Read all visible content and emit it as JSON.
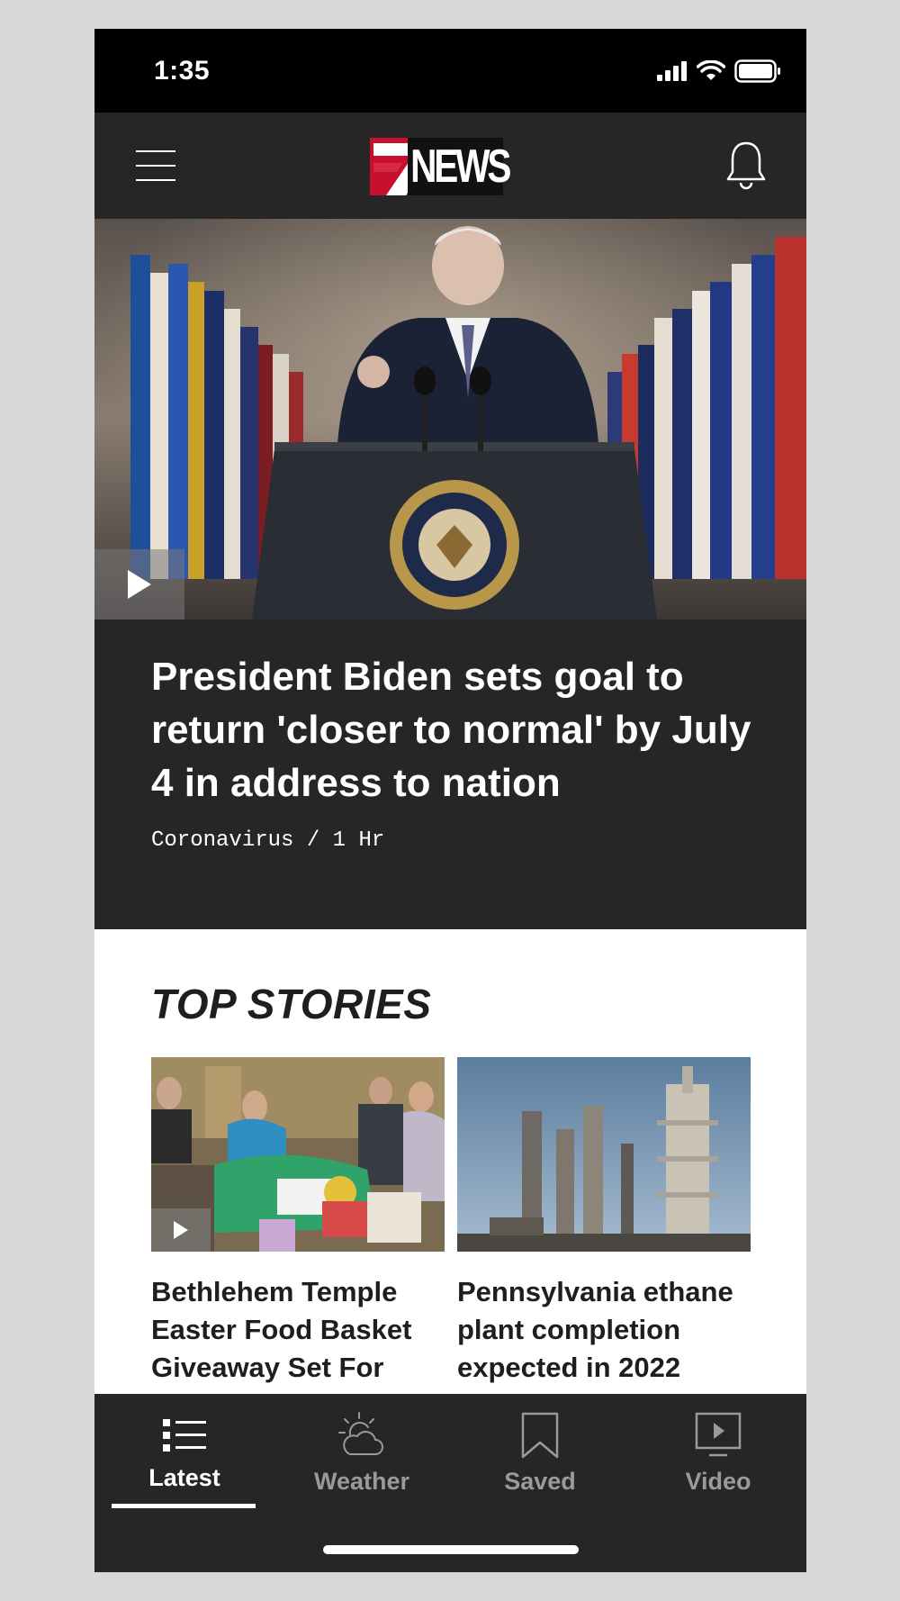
{
  "status_bar": {
    "time": "1:35"
  },
  "header": {
    "logo_text": "NEWS",
    "logo_number": "7"
  },
  "hero": {
    "title": "President Biden sets goal to return 'closer to normal' by July 4 in address to nation",
    "meta": "Coronavirus / 1 Hr"
  },
  "top_stories": {
    "title": "TOP STORIES",
    "items": [
      {
        "headline": "Bethlehem Temple Easter Food Basket Giveaway Set For April",
        "has_video": true
      },
      {
        "headline": "Pennsylvania ethane plant completion expected in 2022",
        "has_video": false
      }
    ]
  },
  "bottom_nav": {
    "items": [
      {
        "label": "Latest",
        "icon": "list-icon",
        "active": true
      },
      {
        "label": "Weather",
        "icon": "weather-icon",
        "active": false
      },
      {
        "label": "Saved",
        "icon": "bookmark-icon",
        "active": false
      },
      {
        "label": "Video",
        "icon": "video-icon",
        "active": false
      }
    ]
  },
  "colors": {
    "brand_red": "#c8102e",
    "dark_bg": "#262626",
    "inactive_nav": "#9a9a9a"
  }
}
